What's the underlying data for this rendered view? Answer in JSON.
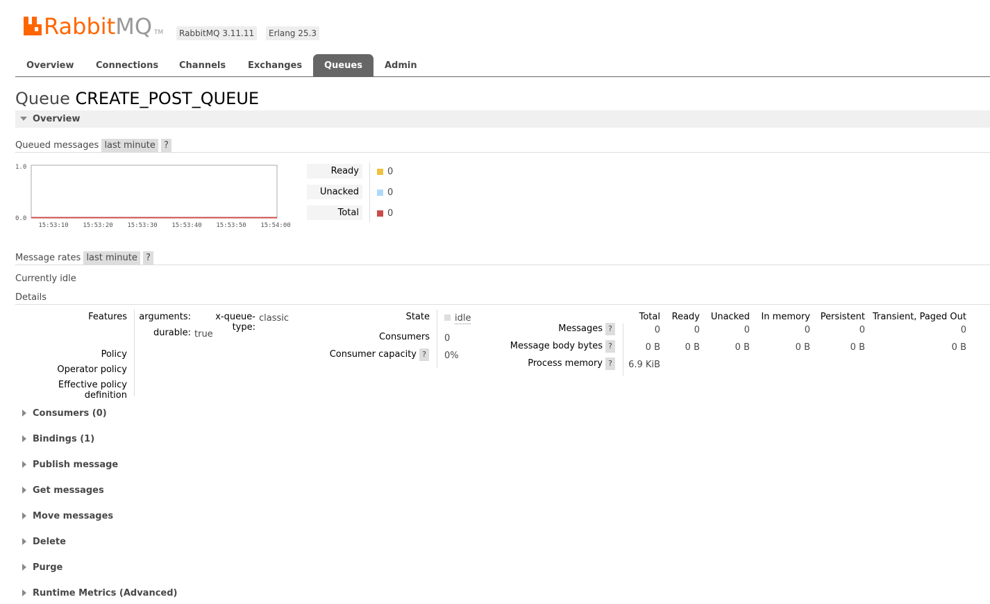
{
  "header": {
    "brand_rabbit": "Rabbit",
    "brand_mq": "MQ",
    "brand_tm": "TM",
    "version_badge": "RabbitMQ 3.11.11",
    "erlang_badge": "Erlang 25.3",
    "brand_color": "#ff6600"
  },
  "nav": {
    "tabs": [
      {
        "label": "Overview"
      },
      {
        "label": "Connections"
      },
      {
        "label": "Channels"
      },
      {
        "label": "Exchanges"
      },
      {
        "label": "Queues"
      },
      {
        "label": "Admin"
      }
    ],
    "active": "Queues"
  },
  "page": {
    "title_prefix": "Queue",
    "queue_name": "CREATE_POST_QUEUE"
  },
  "overview": {
    "section_title": "Overview",
    "queued_messages_label": "Queued messages",
    "range": "last minute",
    "help": "?",
    "legend": [
      {
        "label": "Ready",
        "value": "0",
        "color": "#edc240"
      },
      {
        "label": "Unacked",
        "value": "0",
        "color": "#afd8f8"
      },
      {
        "label": "Total",
        "value": "0",
        "color": "#cb4b4b"
      }
    ],
    "message_rates_label": "Message rates",
    "message_rates_range": "last minute",
    "currently_idle": "Currently idle",
    "details_label": "Details"
  },
  "chart_data": {
    "type": "line",
    "x": [
      "15:53:10",
      "15:53:20",
      "15:53:30",
      "15:53:40",
      "15:53:50",
      "15:54:00"
    ],
    "y_ticks": [
      "1.0",
      "0.0"
    ],
    "ylim": [
      0,
      1
    ],
    "series": [
      {
        "name": "Ready",
        "values": [
          0,
          0,
          0,
          0,
          0,
          0
        ],
        "color": "#edc240"
      },
      {
        "name": "Unacked",
        "values": [
          0,
          0,
          0,
          0,
          0,
          0
        ],
        "color": "#afd8f8"
      },
      {
        "name": "Total",
        "values": [
          0,
          0,
          0,
          0,
          0,
          0
        ],
        "color": "#cb4b4b"
      }
    ]
  },
  "details": {
    "features_label": "Features",
    "arguments_key": "arguments:",
    "arguments_sub_key": "x-queue-type:",
    "arguments_sub_value": "classic",
    "durable_key": "durable:",
    "durable_value": "true",
    "policy_label": "Policy",
    "operator_policy_label": "Operator policy",
    "effective_policy_label": "Effective policy definition",
    "state_label": "State",
    "state_value": "idle",
    "consumers_label": "Consumers",
    "consumers_value": "0",
    "consumer_capacity_label": "Consumer capacity",
    "consumer_capacity_value": "0%",
    "stats_headers": [
      "Total",
      "Ready",
      "Unacked",
      "In memory",
      "Persistent",
      "Transient, Paged Out"
    ],
    "messages_label": "Messages",
    "messages_values": [
      "0",
      "0",
      "0",
      "0",
      "0",
      "0"
    ],
    "body_bytes_label": "Message body bytes",
    "body_bytes_values": [
      "0 B",
      "0 B",
      "0 B",
      "0 B",
      "0 B",
      "0 B"
    ],
    "process_memory_label": "Process memory",
    "process_memory_value": "6.9 KiB"
  },
  "sections": [
    {
      "label": "Consumers (0)"
    },
    {
      "label": "Bindings (1)"
    },
    {
      "label": "Publish message"
    },
    {
      "label": "Get messages"
    },
    {
      "label": "Move messages"
    },
    {
      "label": "Delete"
    },
    {
      "label": "Purge"
    },
    {
      "label": "Runtime Metrics (Advanced)"
    }
  ]
}
